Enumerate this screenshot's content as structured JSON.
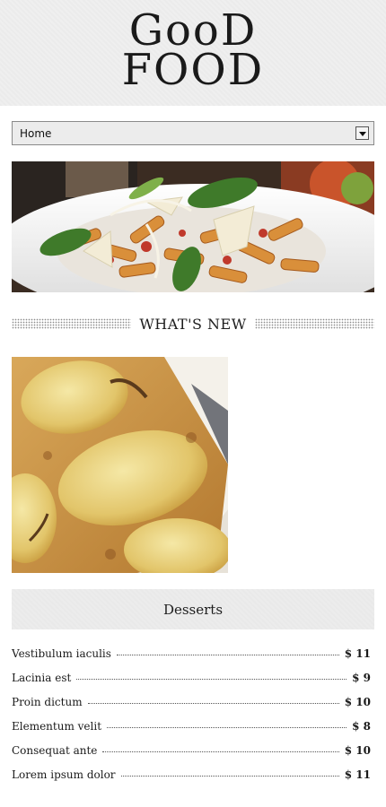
{
  "logo": {
    "line1": "GooD",
    "line2": "FOOD"
  },
  "nav": {
    "selected": "Home"
  },
  "section": {
    "title": "WHAT'S NEW"
  },
  "category": {
    "title": "Desserts"
  },
  "menu": {
    "items": [
      {
        "name": "Vestibulum iaculis",
        "price": "$ 11"
      },
      {
        "name": "Lacinia est",
        "price": "$ 9"
      },
      {
        "name": "Proin dictum",
        "price": "$ 10"
      },
      {
        "name": "Elementum velit",
        "price": "$ 8"
      },
      {
        "name": "Consequat ante",
        "price": "$ 10"
      },
      {
        "name": "Lorem ipsum dolor",
        "price": "$ 11"
      }
    ]
  },
  "colors": {
    "header_bg": "#efefef",
    "bar_bg": "#ececec",
    "text": "#1a1a1a"
  }
}
